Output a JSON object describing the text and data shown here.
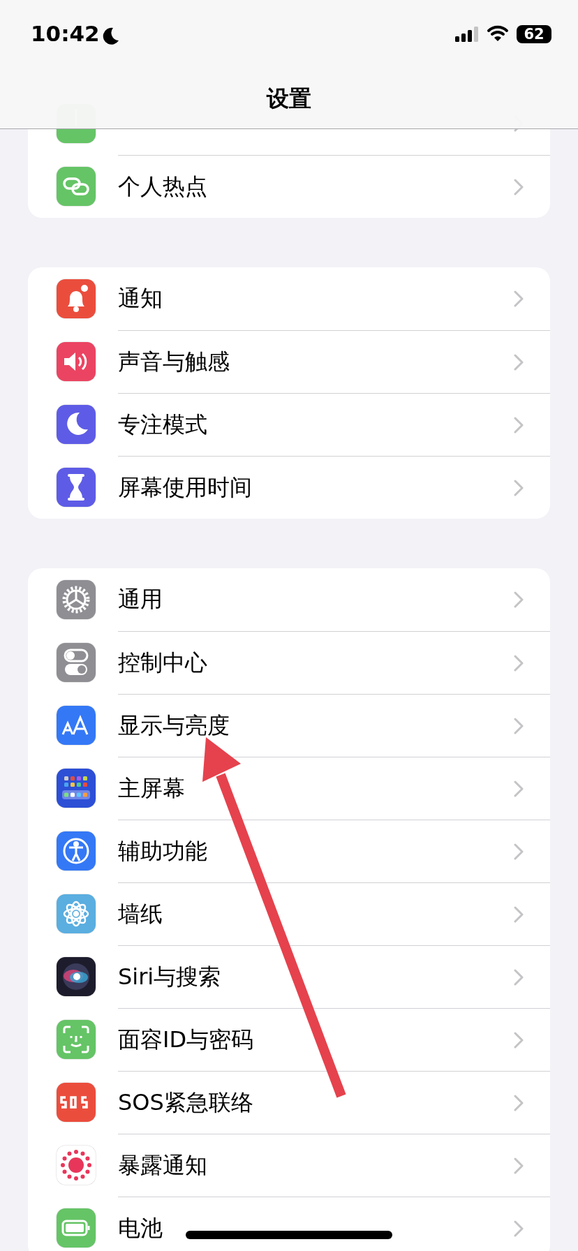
{
  "status_bar": {
    "time": "10:42",
    "battery_percent": "62"
  },
  "title": "设置",
  "groups": [
    {
      "items": [
        {
          "kind": "antenna",
          "color": "#65c466"
        },
        {
          "kind": "hotspot",
          "color": "#65c466",
          "label": "个人热点"
        }
      ]
    },
    {
      "items": [
        {
          "kind": "bell",
          "color": "#eb4d3d",
          "label": "通知"
        },
        {
          "kind": "speaker",
          "color": "#eb4462",
          "label": "声音与触感"
        },
        {
          "kind": "moon",
          "color": "#5e5ce6",
          "label": "专注模式"
        },
        {
          "kind": "hourglass",
          "color": "#5e5ce6",
          "label": "屏幕使用时间"
        }
      ]
    },
    {
      "items": [
        {
          "kind": "gear",
          "color": "#8e8e93",
          "label": "通用"
        },
        {
          "kind": "toggles",
          "color": "#8e8e93",
          "label": "控制中心"
        },
        {
          "kind": "letters",
          "color": "#3478f6",
          "label": "显示与亮度"
        },
        {
          "kind": "grid",
          "color": "#2c4fd6",
          "label": "主屏幕"
        },
        {
          "kind": "person",
          "color": "#3478f6",
          "label": "辅助功能"
        },
        {
          "kind": "flower",
          "color": "#5aaee0",
          "label": "墙纸"
        },
        {
          "kind": "orb",
          "color": "#1c1c2c",
          "label": "Siri与搜索"
        },
        {
          "kind": "face",
          "color": "#65c466",
          "label": "面容ID与密码"
        },
        {
          "kind": "sos",
          "color": "#eb4d3d",
          "label": "SOS紧急联络"
        },
        {
          "kind": "sun",
          "color": "#ffffff",
          "label": "暴露通知"
        },
        {
          "kind": "battery",
          "color": "#65c466",
          "label": "电池"
        }
      ]
    }
  ],
  "annotation": {
    "kind": "arrow",
    "color": "#e5424d"
  }
}
